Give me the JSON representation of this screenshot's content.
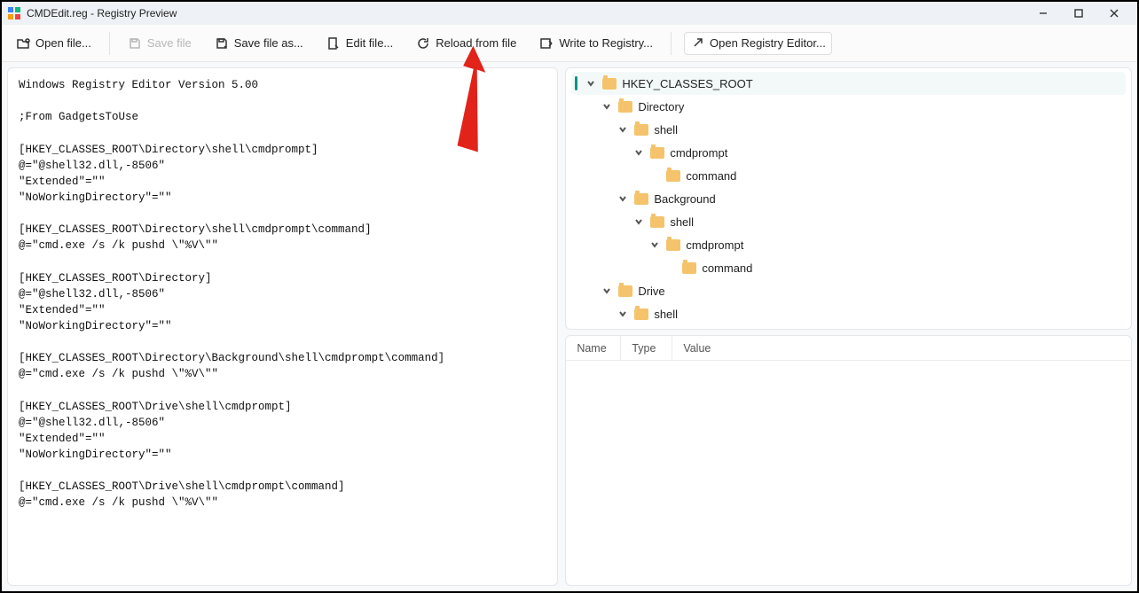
{
  "titlebar": {
    "title": "CMDEdit.reg - Registry Preview"
  },
  "toolbar": {
    "open": "Open file...",
    "save": "Save file",
    "saveas": "Save file as...",
    "edit": "Edit file...",
    "reload": "Reload from file",
    "write": "Write to Registry...",
    "openreg": "Open Registry Editor..."
  },
  "editor": {
    "content": "Windows Registry Editor Version 5.00\n\n;From GadgetsToUse\n\n[HKEY_CLASSES_ROOT\\Directory\\shell\\cmdprompt]\n@=\"@shell32.dll,-8506\"\n\"Extended\"=\"\"\n\"NoWorkingDirectory\"=\"\"\n\n[HKEY_CLASSES_ROOT\\Directory\\shell\\cmdprompt\\command]\n@=\"cmd.exe /s /k pushd \\\"%V\\\"\"\n\n[HKEY_CLASSES_ROOT\\Directory]\n@=\"@shell32.dll,-8506\"\n\"Extended\"=\"\"\n\"NoWorkingDirectory\"=\"\"\n\n[HKEY_CLASSES_ROOT\\Directory\\Background\\shell\\cmdprompt\\command]\n@=\"cmd.exe /s /k pushd \\\"%V\\\"\"\n\n[HKEY_CLASSES_ROOT\\Drive\\shell\\cmdprompt]\n@=\"@shell32.dll,-8506\"\n\"Extended\"=\"\"\n\"NoWorkingDirectory\"=\"\"\n\n[HKEY_CLASSES_ROOT\\Drive\\shell\\cmdprompt\\command]\n@=\"cmd.exe /s /k pushd \\\"%V\\\"\""
  },
  "tree": [
    {
      "label": "HKEY_CLASSES_ROOT",
      "indent": 0,
      "expanded": true,
      "selected": true
    },
    {
      "label": "Directory",
      "indent": 1,
      "expanded": true
    },
    {
      "label": "shell",
      "indent": 2,
      "expanded": true
    },
    {
      "label": "cmdprompt",
      "indent": 3,
      "expanded": true
    },
    {
      "label": "command",
      "indent": 4,
      "expanded": null
    },
    {
      "label": "Background",
      "indent": 2,
      "expanded": true
    },
    {
      "label": "shell",
      "indent": 3,
      "expanded": true
    },
    {
      "label": "cmdprompt",
      "indent": 4,
      "expanded": true
    },
    {
      "label": "command",
      "indent": 5,
      "expanded": null
    },
    {
      "label": "Drive",
      "indent": 1,
      "expanded": true
    },
    {
      "label": "shell",
      "indent": 2,
      "expanded": true
    }
  ],
  "values_columns": {
    "name": "Name",
    "type": "Type",
    "value": "Value"
  },
  "colors": {
    "accent": "#0d9488",
    "folder": "#f5c36b"
  }
}
